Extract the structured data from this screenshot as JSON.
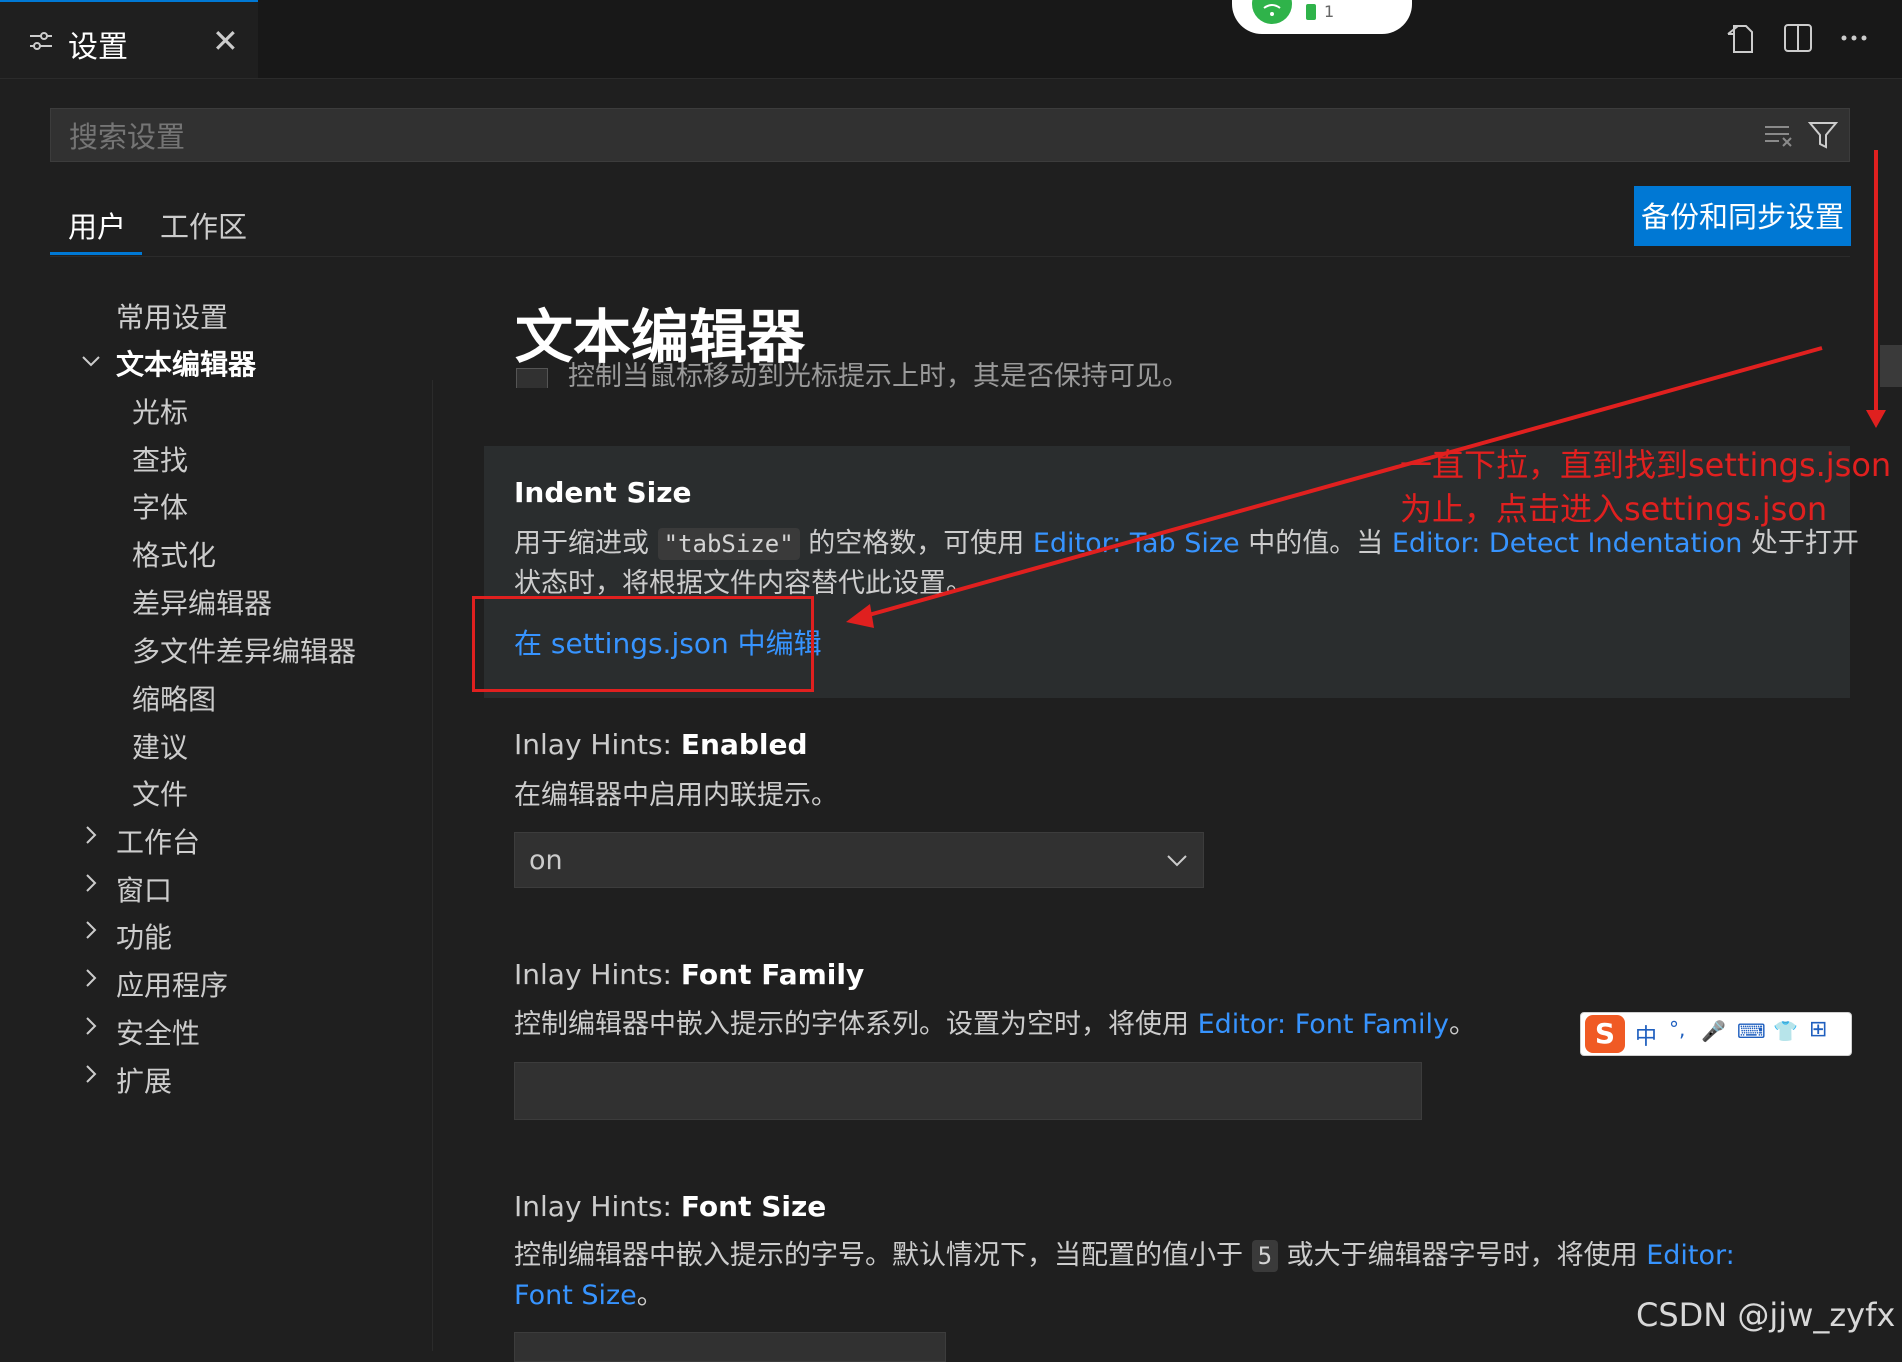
{
  "tab": {
    "icon": "settings-sliders-icon",
    "label": "设置",
    "close_label": "✕"
  },
  "top_actions": [
    "open-settings-json-icon",
    "split-editor-icon",
    "more-actions-icon"
  ],
  "search": {
    "placeholder": "搜索设置",
    "value": ""
  },
  "scope_tabs": [
    {
      "label": "用户",
      "active": true
    },
    {
      "label": "工作区",
      "active": false
    }
  ],
  "sync_button": "备份和同步设置",
  "toc": {
    "common": "常用设置",
    "text_editor": "文本编辑器",
    "children": [
      "光标",
      "查找",
      "字体",
      "格式化",
      "差异编辑器",
      "多文件差异编辑器",
      "缩略图",
      "建议",
      "文件"
    ],
    "collapsed": [
      "工作台",
      "窗口",
      "功能",
      "应用程序",
      "安全性",
      "扩展"
    ]
  },
  "section_title": "文本编辑器",
  "peek_text": "控制当鼠标移动到光标提示上时，其是否保持可见。",
  "settings": {
    "indent_size": {
      "title": "Indent Size",
      "desc_1": "用于缩进或 ",
      "code": "\"tabSize\"",
      "desc_2": " 的空格数，可使用 ",
      "link_1": "Editor: Tab Size",
      "desc_3": " 中的值。当 ",
      "link_2": "Editor: Detect Indentation",
      "desc_4": " 处于打开",
      "desc_line2": "状态时，将根据文件内容替代此设置。",
      "edit_link": "在 settings.json 中编辑"
    },
    "inlay_enabled": {
      "title_prefix": "Inlay Hints: ",
      "title_name": "Enabled",
      "desc": "在编辑器中启用内联提示。",
      "value": "on"
    },
    "inlay_font_family": {
      "title_prefix": "Inlay Hints: ",
      "title_name": "Font Family",
      "desc": "控制编辑器中嵌入提示的字体系列。设置为空时，将使用 ",
      "link": "Editor: Font Family",
      "desc_end": "。",
      "value": ""
    },
    "inlay_font_size": {
      "title_prefix": "Inlay Hints: ",
      "title_name": "Font Size",
      "desc_1": "控制编辑器中嵌入提示的字号。默认情况下，当配置的值小于 ",
      "code": "5",
      "desc_2": " 或大于编辑器字号时，将使用 ",
      "link_a": "Editor:",
      "link_b": "Font Size",
      "desc_end": "。"
    }
  },
  "annotation": {
    "line1": "一直下拉，直到找到settings.json",
    "line2": "为止，点击进入settings.json",
    "color": "#e0201f"
  },
  "hotspot": {
    "badge": "1"
  },
  "ime": {
    "chars": [
      "中",
      "°,",
      "🎤",
      "⌨",
      "👕",
      "⊞"
    ]
  },
  "watermark": "CSDN @jjw_zyfx",
  "colors": {
    "accent": "#0078d4",
    "link": "#3794ff",
    "background": "#1f1f1f",
    "annotation": "#e0201f"
  }
}
